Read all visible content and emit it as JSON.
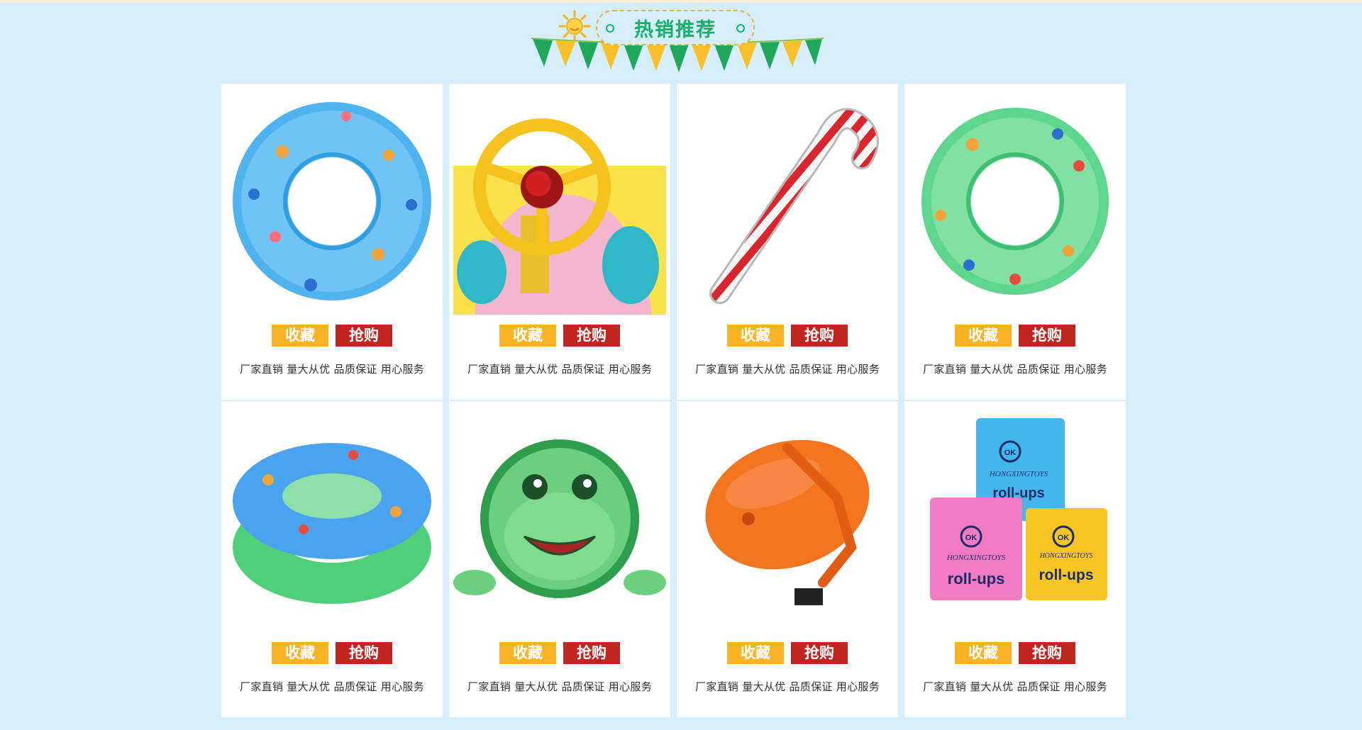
{
  "header": {
    "title": "热销推荐"
  },
  "colors": {
    "background": "#d6eefb",
    "fav": "#f9b224",
    "buy": "#c0261f",
    "title": "#18b06a"
  },
  "products": [
    {
      "image": "blue-swim-ring-icon",
      "fav_label": "收藏",
      "buy_label": "抢购",
      "desc": "厂家直销 量大从优 品质保证 用心服务"
    },
    {
      "image": "steering-wheel-boat-icon",
      "fav_label": "收藏",
      "buy_label": "抢购",
      "desc": "厂家直销 量大从优 品质保证 用心服务"
    },
    {
      "image": "candy-cane-inflatable-icon",
      "fav_label": "收藏",
      "buy_label": "抢购",
      "desc": "厂家直销 量大从优 品质保证 用心服务"
    },
    {
      "image": "green-swim-ring-icon",
      "fav_label": "收藏",
      "buy_label": "抢购",
      "desc": "厂家直销 量大从优 品质保证 用心服务"
    },
    {
      "image": "double-swim-ring-icon",
      "fav_label": "收藏",
      "buy_label": "抢购",
      "desc": "厂家直销 量大从优 品质保证 用心服务"
    },
    {
      "image": "frog-swim-ring-icon",
      "fav_label": "收藏",
      "buy_label": "抢购",
      "desc": "厂家直销 量大从优 品质保证 用心服务"
    },
    {
      "image": "orange-swim-buoy-icon",
      "fav_label": "收藏",
      "buy_label": "抢购",
      "desc": "厂家直销 量大从优 品质保证 用心服务"
    },
    {
      "image": "arm-floats-icon",
      "fav_label": "收藏",
      "buy_label": "抢购",
      "desc": "厂家直销 量大从优 品质保证 用心服务",
      "image_text": {
        "brand": "HONGXINGTOYS",
        "badge": "OK",
        "product": "roll-ups"
      }
    }
  ]
}
